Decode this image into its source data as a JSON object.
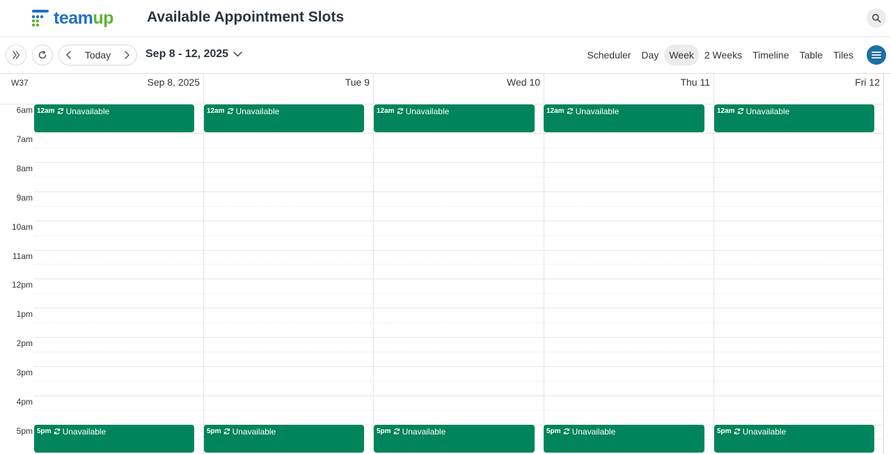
{
  "app": {
    "logo": {
      "part1": "team",
      "part2": "up"
    },
    "title": "Available Appointment Slots"
  },
  "toolbar": {
    "today_label": "Today",
    "date_range": "Sep 8 - 12, 2025",
    "views": [
      {
        "label": "Scheduler",
        "active": false
      },
      {
        "label": "Day",
        "active": false
      },
      {
        "label": "Week",
        "active": true
      },
      {
        "label": "2 Weeks",
        "active": false
      },
      {
        "label": "Timeline",
        "active": false
      },
      {
        "label": "Table",
        "active": false
      },
      {
        "label": "Tiles",
        "active": false
      }
    ]
  },
  "calendar": {
    "week_number": "W37",
    "days": [
      "Sep 8, 2025",
      "Tue 9",
      "Wed 10",
      "Thu 11",
      "Fri 12"
    ],
    "hours": [
      "6am",
      "7am",
      "8am",
      "9am",
      "10am",
      "11am",
      "12pm",
      "1pm",
      "2pm",
      "3pm",
      "4pm",
      "5pm"
    ],
    "events": [
      {
        "day": 0,
        "time": "12am",
        "title": "Unavailable",
        "slot": "morning"
      },
      {
        "day": 1,
        "time": "12am",
        "title": "Unavailable",
        "slot": "morning"
      },
      {
        "day": 2,
        "time": "12am",
        "title": "Unavailable",
        "slot": "morning"
      },
      {
        "day": 3,
        "time": "12am",
        "title": "Unavailable",
        "slot": "morning"
      },
      {
        "day": 4,
        "time": "12am",
        "title": "Unavailable",
        "slot": "morning"
      },
      {
        "day": 0,
        "time": "5pm",
        "title": "Unavailable",
        "slot": "evening"
      },
      {
        "day": 1,
        "time": "5pm",
        "title": "Unavailable",
        "slot": "evening"
      },
      {
        "day": 2,
        "time": "5pm",
        "title": "Unavailable",
        "slot": "evening"
      },
      {
        "day": 3,
        "time": "5pm",
        "title": "Unavailable",
        "slot": "evening"
      },
      {
        "day": 4,
        "time": "5pm",
        "title": "Unavailable",
        "slot": "evening"
      }
    ],
    "event_color": "#00845c"
  },
  "colors": {
    "accent": "#1d6fa5",
    "logo_blue": "#1e73be",
    "logo_green": "#5cb531"
  }
}
